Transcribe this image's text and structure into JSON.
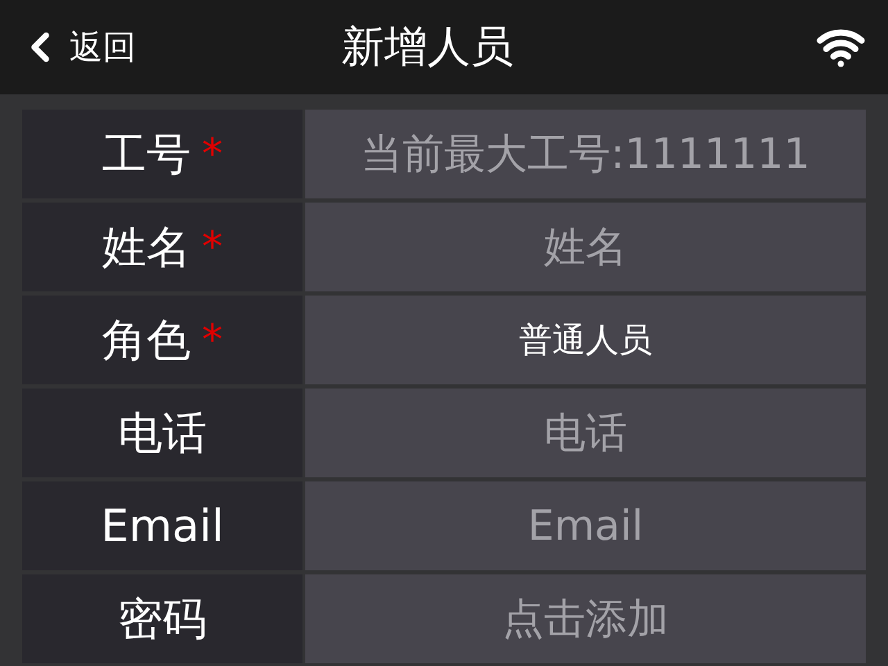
{
  "header": {
    "back_label": "返回",
    "title": "新增人员"
  },
  "fields": [
    {
      "label": "工号",
      "required_mark": "*",
      "kind": "input",
      "placeholder": "当前最大工号:1111111"
    },
    {
      "label": "姓名",
      "required_mark": "*",
      "kind": "input",
      "placeholder": "姓名"
    },
    {
      "label": "角色",
      "required_mark": "*",
      "kind": "select",
      "value": "普通人员"
    },
    {
      "label": "电话",
      "kind": "input",
      "placeholder": "电话"
    },
    {
      "label": "Email",
      "kind": "input",
      "placeholder": "Email"
    },
    {
      "label": "密码",
      "kind": "input",
      "placeholder": "点击添加"
    }
  ]
}
